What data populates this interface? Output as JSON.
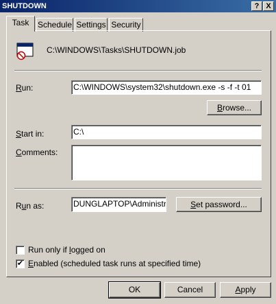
{
  "window": {
    "title": "SHUTDOWN",
    "help_button": "?",
    "close_button": "X"
  },
  "tabs": [
    {
      "label": "Task",
      "active": true
    },
    {
      "label": "Schedule",
      "active": false
    },
    {
      "label": "Settings",
      "active": false
    },
    {
      "label": "Security",
      "active": false
    }
  ],
  "task": {
    "icon": "scheduled-task-icon",
    "path": "C:\\WINDOWS\\Tasks\\SHUTDOWN.job",
    "run_label_u": "R",
    "run_label_rest": "un:",
    "run_value": "C:\\WINDOWS\\system32\\shutdown.exe -s -f -t 01",
    "browse_u": "B",
    "browse_rest": "rowse...",
    "start_in_label_u": "S",
    "start_in_label_rest": "tart in:",
    "start_in_value": "C:\\",
    "comments_label_u": "C",
    "comments_label_rest": "omments:",
    "comments_value": "",
    "run_as_label_pre": "R",
    "run_as_label_u": "u",
    "run_as_label_rest": "n as:",
    "run_as_value": "DUNGLAPTOP\\Administrat",
    "set_password_u": "S",
    "set_password_rest": "et password...",
    "run_only_pre": "Run only if ",
    "run_only_u": "l",
    "run_only_rest": "ogged on",
    "run_only_checked": false,
    "enabled_u": "E",
    "enabled_rest": "nabled (scheduled task runs at specified time)",
    "enabled_checked": true
  },
  "footer": {
    "ok": "OK",
    "cancel": "Cancel",
    "apply_u": "A",
    "apply_rest": "pply"
  }
}
